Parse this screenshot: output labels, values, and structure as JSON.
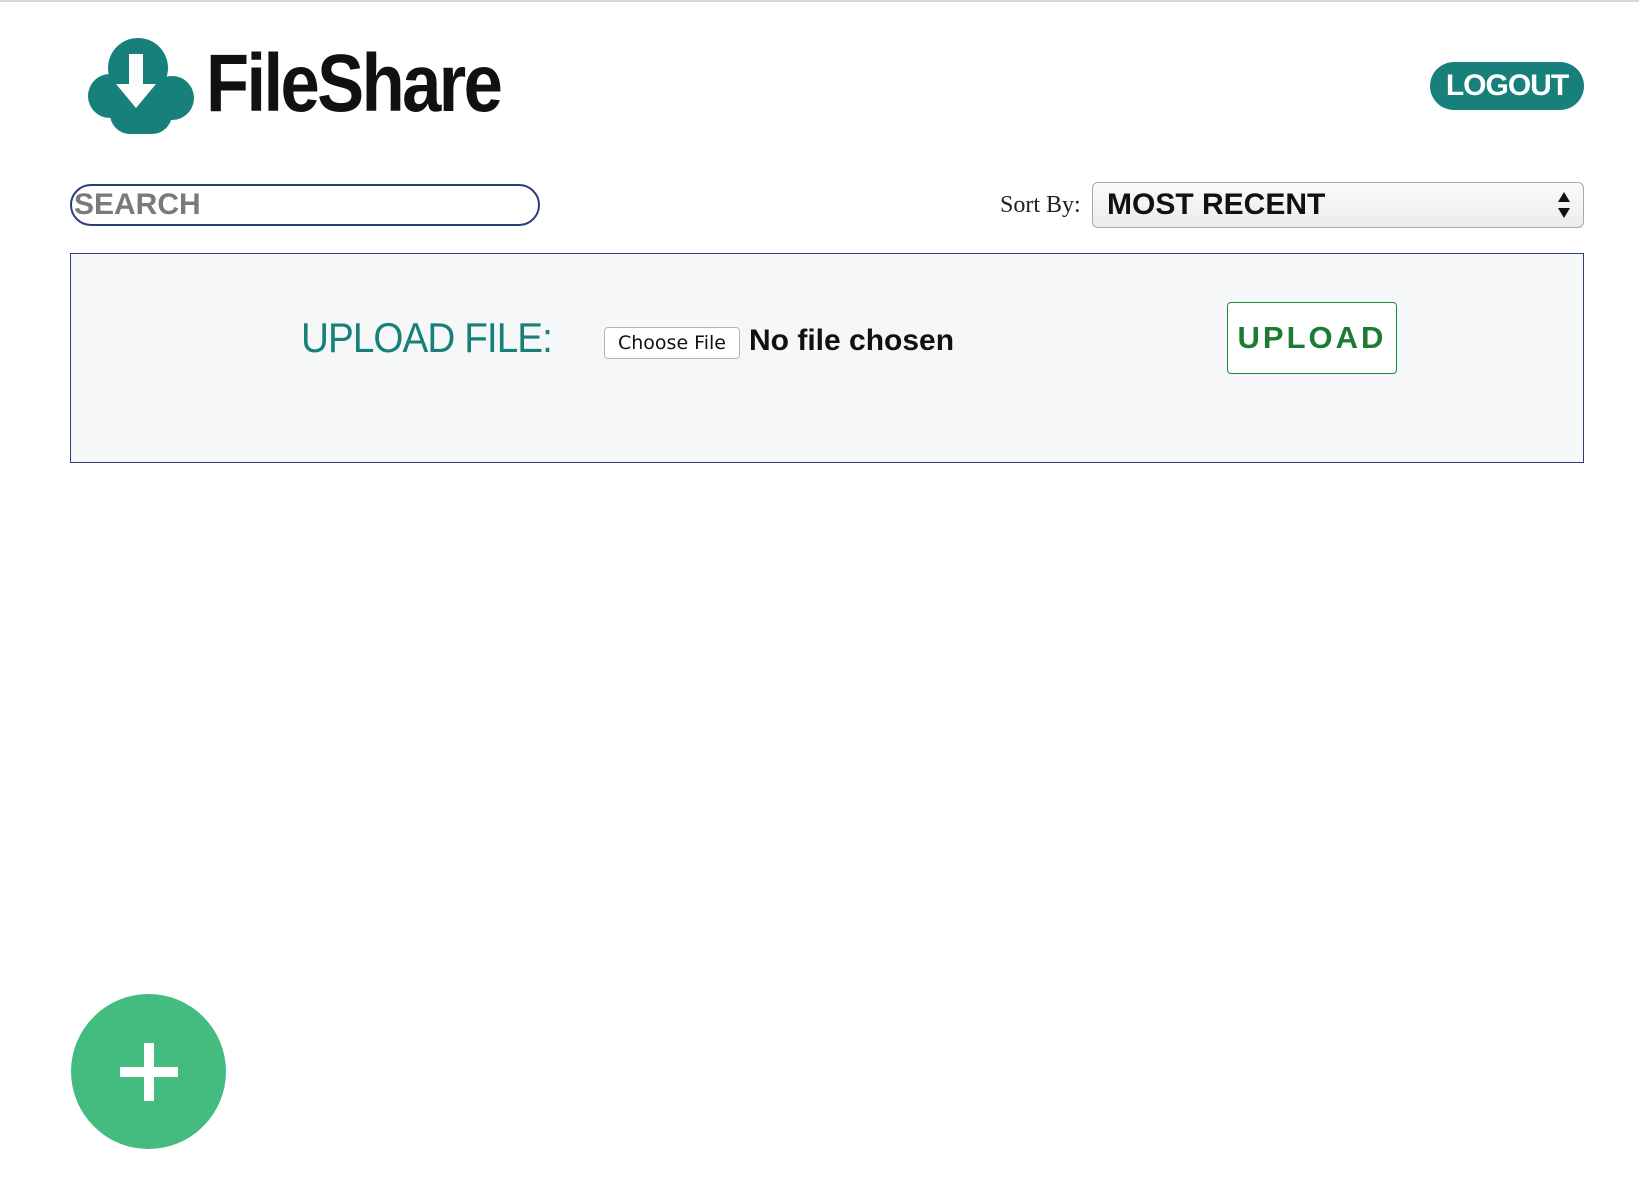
{
  "header": {
    "logo_text": "FileShare",
    "logo_icon": "cloud-download-icon",
    "logout_label": "LOGOUT"
  },
  "toolbar": {
    "search_placeholder": "SEARCH",
    "search_value": "",
    "sort_label": "Sort By:",
    "sort_selected": "MOST RECENT",
    "sort_icon": "select-arrows-icon"
  },
  "upload": {
    "label": "UPLOAD FILE:",
    "choose_file_label": "Choose File",
    "file_status": "No file chosen",
    "upload_button_label": "UPLOAD"
  },
  "fab": {
    "icon": "plus-icon"
  },
  "colors": {
    "brand_teal": "#17807a",
    "upload_green": "#1d7a32",
    "fab_green": "#45bc7f",
    "panel_border": "#2c3e7a",
    "panel_background": "#f6f7f9"
  }
}
